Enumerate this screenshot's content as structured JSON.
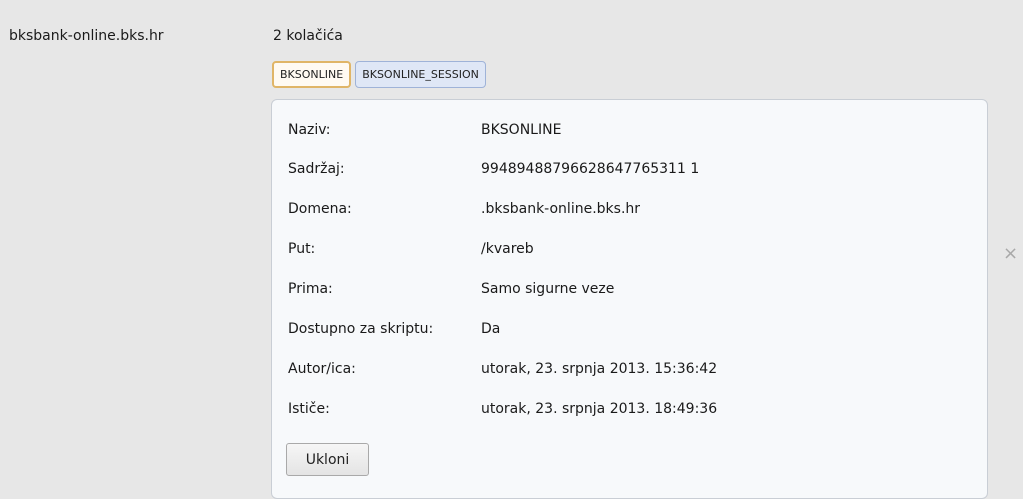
{
  "site": {
    "domain": "bksbank-online.bks.hr",
    "count_label": "2 kolačića"
  },
  "cookie_tabs": [
    {
      "label": "BKSONLINE",
      "selected": true
    },
    {
      "label": "BKSONLINE_SESSION",
      "selected": false
    }
  ],
  "details": [
    {
      "label": "Naziv:",
      "value": "BKSONLINE"
    },
    {
      "label": "Sadržaj:",
      "value": "99489488796628647765311 1"
    },
    {
      "label": "Domena:",
      "value": ".bksbank-online.bks.hr"
    },
    {
      "label": "Put:",
      "value": "/kvareb"
    },
    {
      "label": "Prima:",
      "value": "Samo sigurne veze"
    },
    {
      "label": "Dostupno za skriptu:",
      "value": "Da"
    },
    {
      "label": "Autor/ica:",
      "value": "utorak, 23. srpnja 2013. 15:36:42"
    },
    {
      "label": "Ističe:",
      "value": "utorak, 23. srpnja 2013. 18:49:36"
    }
  ],
  "remove_button": "Ukloni",
  "close_icon": "×",
  "colors": {
    "background": "#e7e7e7",
    "selected_chip_border": "#e0b567",
    "chip_background": "#dfe7f6",
    "panel_background": "#f7f9fb"
  }
}
